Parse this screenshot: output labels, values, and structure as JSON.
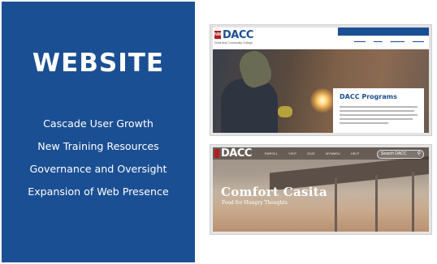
{
  "panel": {
    "title": "WEBSITE",
    "items": [
      "Cascade User Growth",
      "New Training Resources",
      "Governance and Oversight",
      "Expansion of Web Presence"
    ]
  },
  "shot1": {
    "logo": "DACC",
    "logo_badge": "NM",
    "logo_subtitle": "Doña Ana Community College",
    "hero_heading": "DACC Programs"
  },
  "shot2": {
    "logo": "DACC",
    "nav_links": [
      "ENROLL",
      "VISIT",
      "GIVE",
      "MYNMSU",
      "HELP"
    ],
    "search_placeholder": "Search DACC",
    "hero_title": "Comfort Casita",
    "hero_subtitle": "Food for Hungry Thoughts"
  },
  "colors": {
    "brand_blue": "#1b4f93",
    "nm_red": "#b11f24"
  }
}
